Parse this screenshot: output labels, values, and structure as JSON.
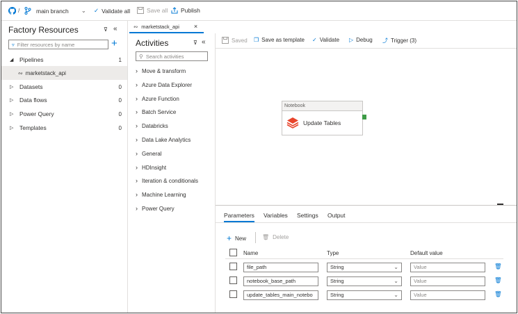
{
  "topbar": {
    "branch_label": "main branch",
    "validate_all_label": "Validate all",
    "save_all_label": "Save all",
    "publish_label": "Publish"
  },
  "factory": {
    "title": "Factory Resources",
    "filter_placeholder": "Filter resources by name",
    "items": [
      {
        "label": "Pipelines",
        "count": "1"
      },
      {
        "label": "marketstack_api",
        "count": ""
      },
      {
        "label": "Datasets",
        "count": "0"
      },
      {
        "label": "Data flows",
        "count": "0"
      },
      {
        "label": "Power Query",
        "count": "0"
      },
      {
        "label": "Templates",
        "count": "0"
      }
    ]
  },
  "activities": {
    "title": "Activities",
    "search_placeholder": "Search activities",
    "items": [
      "Move & transform",
      "Azure Data Explorer",
      "Azure Function",
      "Batch Service",
      "Databricks",
      "Data Lake Analytics",
      "General",
      "HDInsight",
      "Iteration & conditionals",
      "Machine Learning",
      "Power Query"
    ]
  },
  "tab": {
    "label": "marketstack_api"
  },
  "toolbar": {
    "saved_label": "Saved",
    "save_template_label": "Save as template",
    "validate_label": "Validate",
    "debug_label": "Debug",
    "trigger_label": "Trigger (3)"
  },
  "canvas": {
    "node_type": "Notebook",
    "node_name": "Update Tables"
  },
  "bottom": {
    "tabs": [
      "Parameters",
      "Variables",
      "Settings",
      "Output"
    ],
    "new_label": "New",
    "delete_label": "Delete",
    "col_name": "Name",
    "col_type": "Type",
    "col_default": "Default value",
    "rows": [
      {
        "name": "file_path",
        "type": "String",
        "value_placeholder": "Value"
      },
      {
        "name": "notebook_base_path",
        "type": "String",
        "value_placeholder": "Value"
      },
      {
        "name": "update_tables_main_notebo",
        "type": "String",
        "value_placeholder": "Value"
      }
    ]
  },
  "colors": {
    "accent": "#0078d4",
    "node_handle": "#3e9b46",
    "databricks": "#e8452c"
  }
}
